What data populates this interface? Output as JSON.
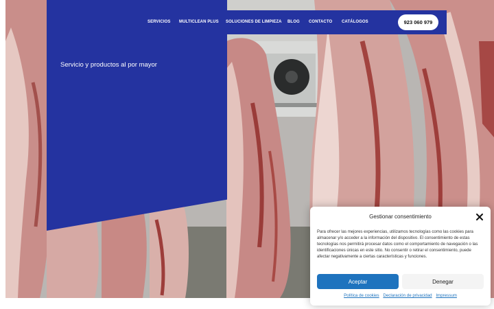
{
  "nav": {
    "items": [
      {
        "label": "SERVICIOS"
      },
      {
        "label": "MULTICLEAN PLUS"
      },
      {
        "label": "SOLUCIONES DE LIMPIEZA"
      },
      {
        "label": "BLOG"
      },
      {
        "label": "CONTACTO"
      },
      {
        "label": "CATÁLOGOS"
      }
    ],
    "phone": "923 060 979"
  },
  "hero": {
    "tagline": "Servicio y productos al por mayor",
    "image_icon": "meat-carcasses-photo"
  },
  "consent": {
    "title": "Gestionar consentimiento",
    "close_icon": "close-icon",
    "body": "Para ofrecer las mejores experiencias, utilizamos tecnologías como las cookies para almacenar y/o acceder a la información del dispositivo. El consentimiento de estas tecnologías nos permitirá procesar datos como el comportamiento de navegación o las identificaciones únicas en este sitio. No consentir o retirar el consentimiento, puede afectar negativamente a ciertas características y funciones.",
    "accept_label": "Aceptar",
    "deny_label": "Denegar",
    "links": {
      "cookies": "Política de cookies",
      "privacy": "Declaración de privacidad",
      "impressum": "Impressum"
    }
  },
  "colors": {
    "brand_blue": "#2433a0",
    "accept_blue": "#1e73be"
  }
}
